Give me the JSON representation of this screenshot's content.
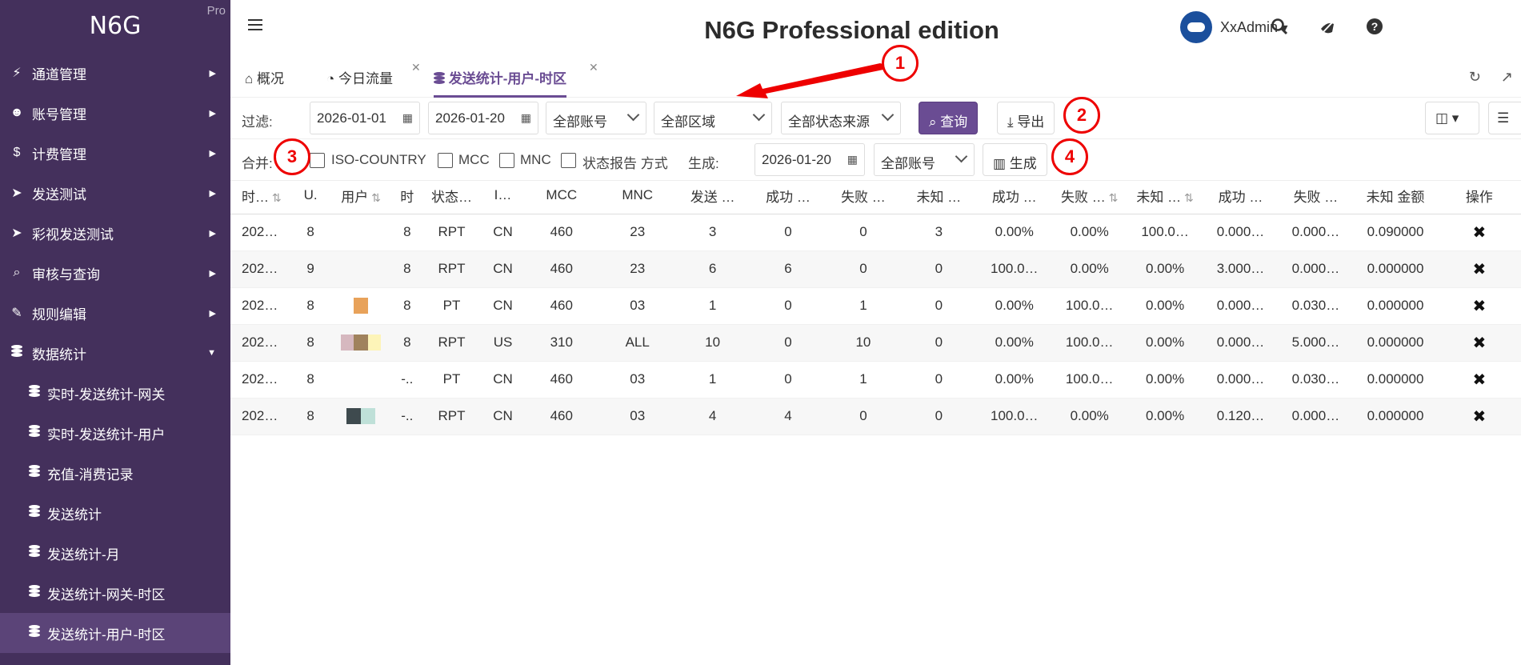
{
  "sidebar": {
    "brand": "N6G",
    "pro": "Pro",
    "menu": [
      {
        "label": "通道管理",
        "icon": "bolt-icon"
      },
      {
        "label": "账号管理",
        "icon": "users-icon"
      },
      {
        "label": "计费管理",
        "icon": "dollar-icon"
      },
      {
        "label": "发送测试",
        "icon": "paper-plane-icon"
      },
      {
        "label": "彩视发送测试",
        "icon": "paper-plane-icon"
      },
      {
        "label": "审核与查询",
        "icon": "search-icon"
      },
      {
        "label": "规则编辑",
        "icon": "edit-icon"
      },
      {
        "label": "数据统计",
        "icon": "database-icon"
      }
    ],
    "submenu": [
      {
        "label": "实时-发送统计-网关"
      },
      {
        "label": "实时-发送统计-用户"
      },
      {
        "label": "充值-消费记录"
      },
      {
        "label": "发送统计"
      },
      {
        "label": "发送统计-月"
      },
      {
        "label": "发送统计-网关-时区"
      },
      {
        "label": "发送统计-用户-时区"
      }
    ]
  },
  "header": {
    "title": "N6G Professional edition",
    "username": "XxAdmin"
  },
  "tabs": [
    {
      "label": "概况",
      "icon": "home-icon"
    },
    {
      "label": "今日流量",
      "icon": "clock-icon"
    },
    {
      "label": "发送统计-用户-时区",
      "icon": "database-icon"
    }
  ],
  "filter": {
    "label": "过滤:",
    "date_from": "2026-01-01",
    "date_to": "2026-01-20",
    "account": "全部账号",
    "region": "全部区域",
    "status_source": "全部状态来源",
    "query_button": "查询",
    "export_button": "导出"
  },
  "merge": {
    "label": "合并:",
    "options": [
      "ISO-COUNTRY",
      "MCC",
      "MNC",
      "状态报告 方式"
    ],
    "generate_label": "生成:",
    "generate_date": "2026-01-20",
    "generate_account": "全部账号",
    "generate_button": "生成"
  },
  "table": {
    "columns": [
      "时…",
      "U.",
      "用户",
      "时",
      "状态…",
      "I…",
      "MCC",
      "MNC",
      "发送 …",
      "成功 …",
      "失败 …",
      "未知 …",
      "成功 …",
      "失败 …",
      "未知 …",
      "成功 …",
      "失败 …",
      "未知 金额",
      "操作"
    ],
    "rows": [
      [
        "202…",
        "8",
        "",
        "8",
        "RPT",
        "CN",
        "460",
        "23",
        "3",
        "0",
        "0",
        "3",
        "0.00%",
        "0.00%",
        "100.0…",
        "0.000…",
        "0.000…",
        "0.090000"
      ],
      [
        "202…",
        "9",
        "",
        "8",
        "RPT",
        "CN",
        "460",
        "23",
        "6",
        "6",
        "0",
        "0",
        "100.0…",
        "0.00%",
        "0.00%",
        "3.000…",
        "0.000…",
        "0.000000"
      ],
      [
        "202…",
        "8",
        "",
        "8",
        "PT",
        "CN",
        "460",
        "03",
        "1",
        "0",
        "1",
        "0",
        "0.00%",
        "100.0…",
        "0.00%",
        "0.000…",
        "0.030…",
        "0.000000"
      ],
      [
        "202…",
        "8",
        "",
        "8",
        "RPT",
        "US",
        "310",
        "ALL",
        "10",
        "0",
        "10",
        "0",
        "0.00%",
        "100.0…",
        "0.00%",
        "0.000…",
        "5.000…",
        "0.000000"
      ],
      [
        "202…",
        "8",
        "",
        "-..",
        "PT",
        "CN",
        "460",
        "03",
        "1",
        "0",
        "1",
        "0",
        "0.00%",
        "100.0…",
        "0.00%",
        "0.000…",
        "0.030…",
        "0.000000"
      ],
      [
        "202…",
        "8",
        "",
        "-..",
        "RPT",
        "CN",
        "460",
        "03",
        "4",
        "4",
        "0",
        "0",
        "100.0…",
        "0.00%",
        "0.00%",
        "0.120…",
        "0.000…",
        "0.000000"
      ]
    ]
  },
  "annotations": [
    "1",
    "2",
    "3",
    "4"
  ],
  "colors": {
    "sidebar": "#44305c",
    "accent": "#6a4c93",
    "annotation": "#e00000"
  }
}
